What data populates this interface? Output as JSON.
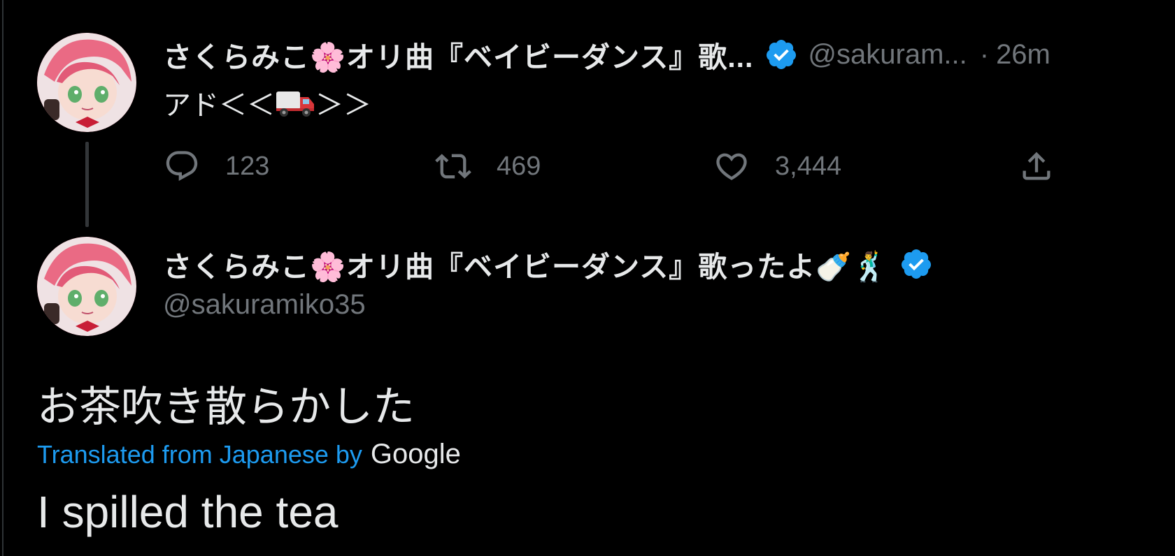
{
  "tweet1": {
    "display_name": "さくらみこ🌸オリ曲『ベイビーダンス』歌...",
    "handle": "@sakuram...",
    "separator": "·",
    "time": "26m",
    "text_prefix": "アド＜＜",
    "text_suffix": "＞＞",
    "emoji_icon": "delivery-truck-icon",
    "replies": "123",
    "retweets": "469",
    "likes": "3,444"
  },
  "tweet2": {
    "display_name": "さくらみこ🌸オリ曲『ベイビーダンス』歌ったよ🍼🕺",
    "handle": "@sakuramiko35",
    "text": "お茶吹き散らかした",
    "translated_label": "Translated from Japanese by",
    "translator": "Google",
    "translation": "I spilled the tea"
  },
  "colors": {
    "background": "#000000",
    "text": "#e7e9ea",
    "muted": "#71767b",
    "accent": "#1d9bf0",
    "verified": "#1d9bf0"
  }
}
